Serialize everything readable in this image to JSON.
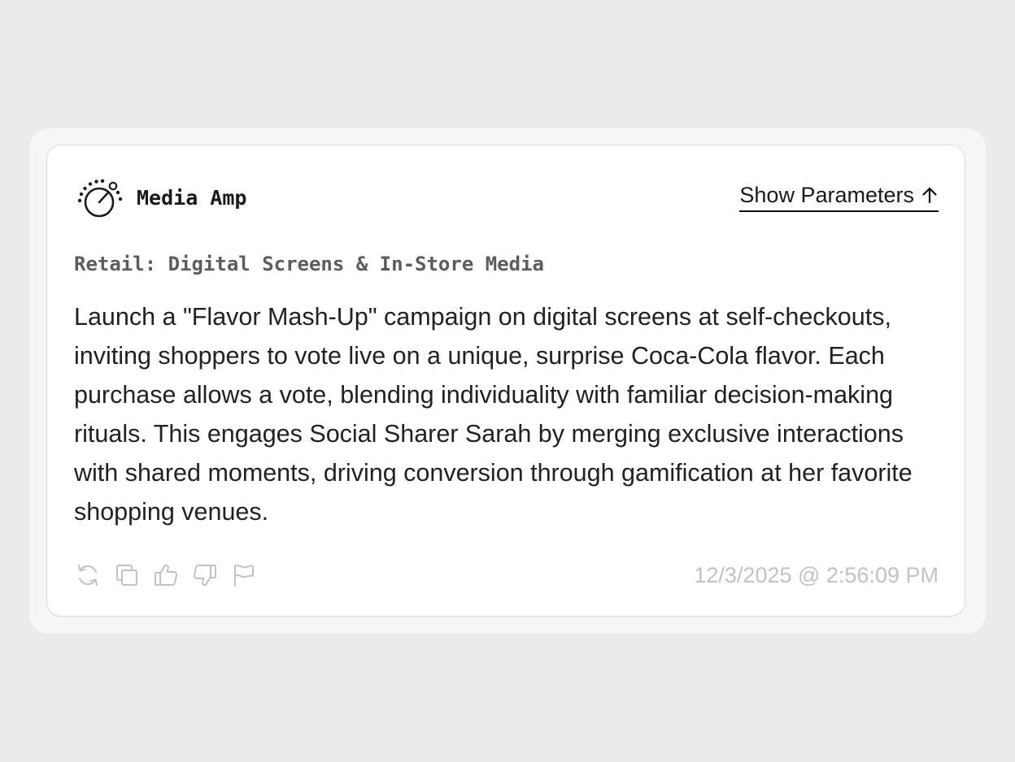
{
  "card": {
    "brand_name": "Media Amp",
    "brand_icon": "dial-gauge-icon",
    "show_parameters_label": "Show Parameters",
    "show_parameters_icon": "arrow-up-icon",
    "subtitle": "Retail: Digital Screens & In-Store Media",
    "body": "Launch a \"Flavor Mash-Up\" campaign on digital screens at self-checkouts, inviting shoppers to vote live on a unique, surprise Coca-Cola flavor. Each purchase allows a vote, blending individuality with familiar decision-making rituals. This engages Social Sharer Sarah by merging exclusive interactions with shared moments, driving conversion through gamification at her favorite shopping venues.",
    "timestamp": "12/3/2025 @ 2:56:09 PM"
  },
  "actions": [
    {
      "icon": "regenerate-icon"
    },
    {
      "icon": "copy-icon"
    },
    {
      "icon": "thumbs-up-icon"
    },
    {
      "icon": "thumbs-down-icon"
    },
    {
      "icon": "flag-icon"
    }
  ],
  "colors": {
    "page_background": "#ebebeb",
    "outer_panel": "#f6f6f6",
    "card_background": "#ffffff",
    "text_primary": "#222222",
    "subtitle": "#5c5c5c",
    "muted_icons": "#c2c2c2"
  }
}
